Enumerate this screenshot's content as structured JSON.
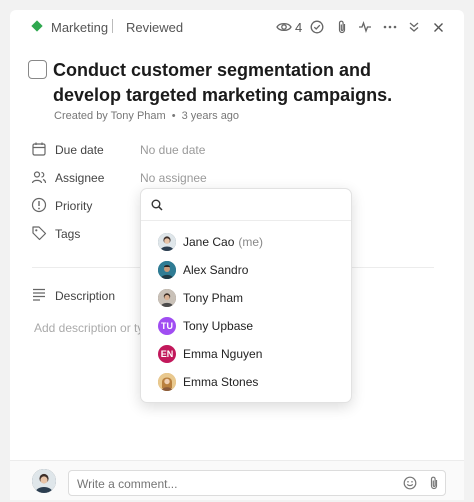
{
  "breadcrumb": {
    "project": "Marketing",
    "status": "Reviewed"
  },
  "toolbar": {
    "watchers_count": "4"
  },
  "task": {
    "title": "Conduct customer segmentation and develop targeted marketing campaigns.",
    "created_by": "Created by Tony Pham",
    "created_ago": "3 years ago"
  },
  "fields": {
    "due_date": {
      "label": "Due date",
      "value": "No due date"
    },
    "assignee": {
      "label": "Assignee",
      "value": "No assignee"
    },
    "priority": {
      "label": "Priority"
    },
    "tags": {
      "label": "Tags"
    }
  },
  "description": {
    "label": "Description",
    "placeholder": "Add description or typ"
  },
  "assignee_dropdown": {
    "search_placeholder": "",
    "users": [
      {
        "name": "Jane Cao",
        "suffix": "(me)",
        "initials": "",
        "color": "#5a6a78"
      },
      {
        "name": "Alex Sandro",
        "suffix": "",
        "initials": "",
        "color": "#2d6f86"
      },
      {
        "name": "Tony Pham",
        "suffix": "",
        "initials": "",
        "color": "#6b5a4d"
      },
      {
        "name": "Tony Upbase",
        "suffix": "",
        "initials": "TU",
        "color": "#a04df2"
      },
      {
        "name": "Emma Nguyen",
        "suffix": "",
        "initials": "EN",
        "color": "#c2185b"
      },
      {
        "name": "Emma Stones",
        "suffix": "",
        "initials": "",
        "color": "#d9a25a"
      }
    ]
  },
  "comment": {
    "placeholder": "Write a comment..."
  },
  "colors": {
    "project_diamond": "#2fa84f"
  }
}
